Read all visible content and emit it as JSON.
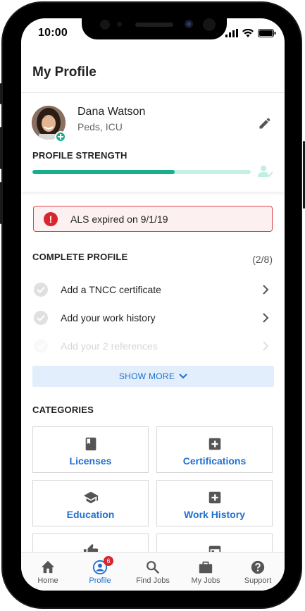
{
  "status_bar": {
    "time": "10:00"
  },
  "header": {
    "title": "My Profile"
  },
  "profile": {
    "name": "Dana Watson",
    "specialty": "Peds, ICU",
    "strength_label": "PROFILE STRENGTH",
    "strength_fraction": 0.65
  },
  "alert": {
    "text": "ALS expired on 9/1/19"
  },
  "complete_profile": {
    "title": "COMPLETE PROFILE",
    "count": "(2/8)",
    "items": [
      {
        "label": "Add a TNCC certificate"
      },
      {
        "label": "Add your work history"
      },
      {
        "label": "Add your 2 references"
      }
    ],
    "show_more": "SHOW MORE"
  },
  "categories": {
    "title": "CATEGORIES",
    "items": [
      {
        "label": "Licenses",
        "icon": "book-icon"
      },
      {
        "label": "Certifications",
        "icon": "plus-box-icon"
      },
      {
        "label": "Education",
        "icon": "graduation-cap-icon"
      },
      {
        "label": "Work History",
        "icon": "plus-box-icon"
      },
      {
        "label": "",
        "icon": "thumbs-up-icon"
      },
      {
        "label": "",
        "icon": "calendar-icon"
      }
    ]
  },
  "tabbar": {
    "tabs": [
      {
        "label": "Home",
        "icon": "home-icon"
      },
      {
        "label": "Profile",
        "icon": "profile-icon",
        "badge": "6",
        "active": true
      },
      {
        "label": "Find Jobs",
        "icon": "search-icon"
      },
      {
        "label": "My Jobs",
        "icon": "briefcase-icon"
      },
      {
        "label": "Support",
        "icon": "help-icon"
      }
    ]
  },
  "colors": {
    "accent_blue": "#1f6fd0",
    "strength_green": "#16b18c",
    "alert_red": "#d8252e"
  }
}
